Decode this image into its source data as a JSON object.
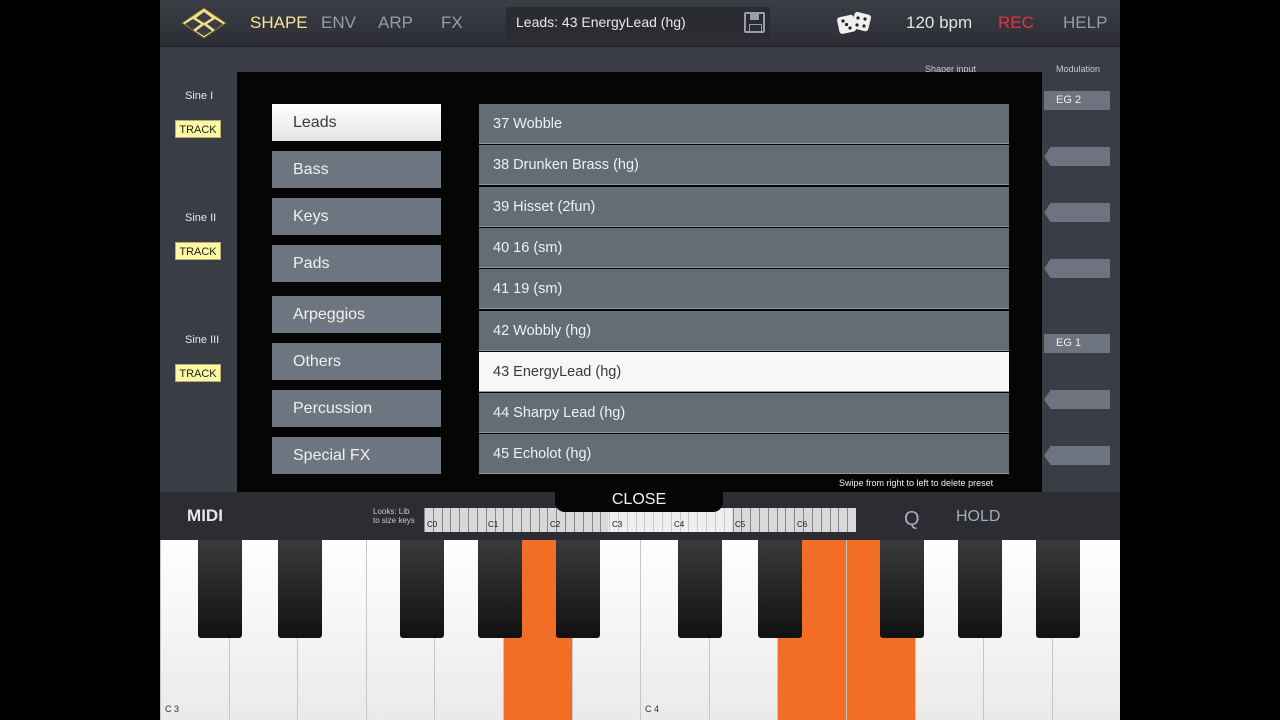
{
  "topbar": {
    "tabs": [
      "SHAPE",
      "ENV",
      "ARP",
      "FX"
    ],
    "active_tab": "SHAPE",
    "preset_name": "Leads: 43 EnergyLead (hg)",
    "bpm": "120 bpm",
    "rec": "REC",
    "help": "HELP",
    "colors": {
      "active": "#f4e79a",
      "rec": "#e0344a"
    }
  },
  "synth_panel": {
    "oscillators": [
      "Sine I",
      "Sine II",
      "Sine III"
    ],
    "track_label": "TRACK",
    "shaper_input": "Shaper input",
    "modulation_header": "Modulation",
    "modulation_sources": [
      "EG 2",
      "EG 1"
    ]
  },
  "preset_browser": {
    "categories": [
      "Leads",
      "Bass",
      "Keys",
      "Pads",
      "Arpeggios",
      "Others",
      "Percussion",
      "Special FX"
    ],
    "selected_category": "Leads",
    "presets": [
      "37 Wobble",
      "38 Drunken Brass (hg)",
      "39 Hisset (2fun)",
      "40 16 (sm)",
      "41 19 (sm)",
      "42 Wobbly (hg)",
      "43 EnergyLead (hg)",
      "44 Sharpy Lead (hg)",
      "45 Echolot (hg)"
    ],
    "selected_preset": "43 EnergyLead (hg)",
    "swipe_hint": "Swipe from right to left to delete preset",
    "close_label": "CLOSE"
  },
  "keyboard_bar": {
    "midi_label": "MIDI",
    "looks_hint_1": "Looks: Lib",
    "looks_hint_2": "to size keys",
    "mini_octave_labels": [
      "C0",
      "C1",
      "C2",
      "C3",
      "C4",
      "C5",
      "C6"
    ],
    "quantize": "Q",
    "hold": "HOLD"
  },
  "keyboard": {
    "octave_labels": [
      "C 3",
      "C 4"
    ],
    "accent_color": "#f26d25"
  }
}
